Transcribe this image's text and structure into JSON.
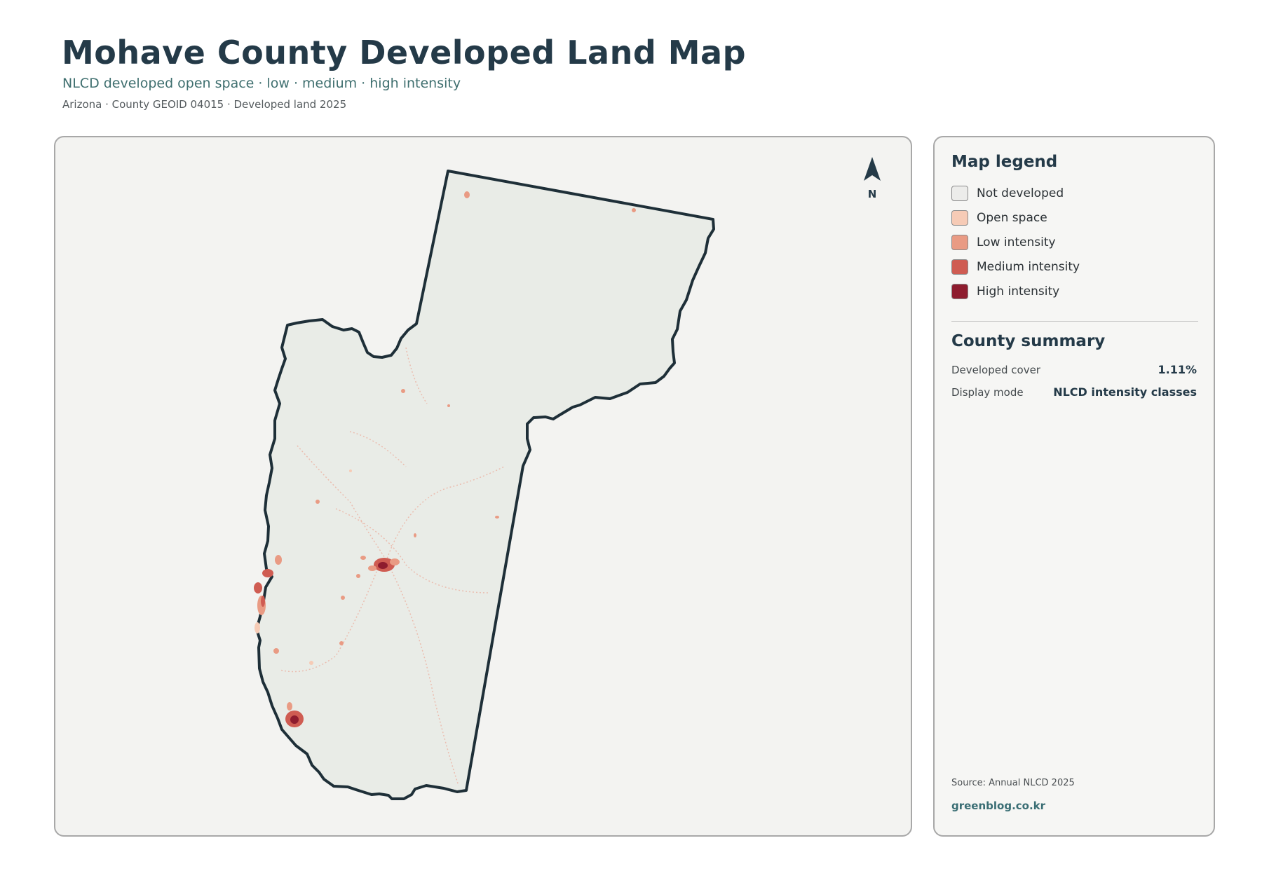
{
  "header": {
    "title": "Mohave County Developed Land Map",
    "subtitle": "NLCD developed open space · low · medium · high intensity",
    "meta": "Arizona · County GEOID 04015 · Developed land 2025"
  },
  "map": {
    "north_label": "N",
    "county_fill": "#e9ece7",
    "boundary_color": "#1e2f38",
    "background": "#f3f3f1"
  },
  "legend": {
    "title": "Map legend",
    "items": [
      {
        "label": "Not developed",
        "color": "#ececea"
      },
      {
        "label": "Open space",
        "color": "#f6cbb6"
      },
      {
        "label": "Low intensity",
        "color": "#e99b84"
      },
      {
        "label": "Medium intensity",
        "color": "#cf5c52"
      },
      {
        "label": "High intensity",
        "color": "#8e1c2e"
      }
    ]
  },
  "summary": {
    "title": "County summary",
    "rows": [
      {
        "key": "Developed cover",
        "value": "1.11%"
      },
      {
        "key": "Display mode",
        "value": "NLCD intensity classes"
      }
    ]
  },
  "footer": {
    "source": "Source: Annual NLCD 2025",
    "brand": "greenblog.co.kr"
  }
}
